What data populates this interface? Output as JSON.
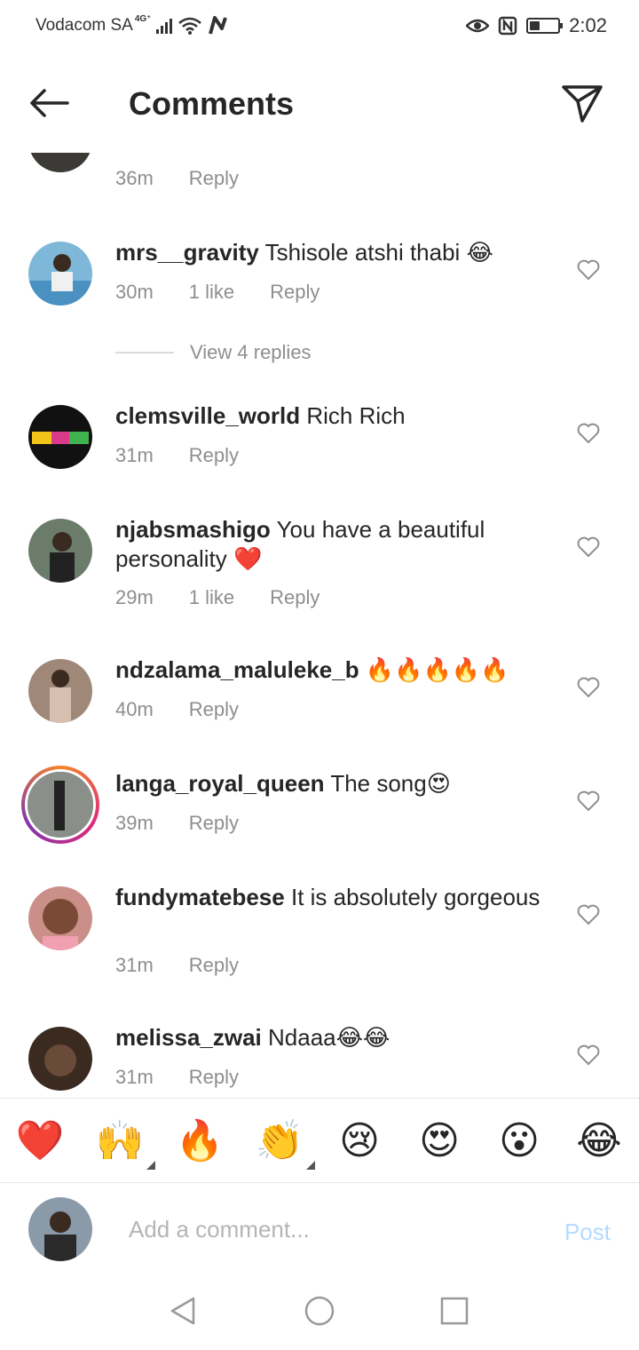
{
  "status_bar": {
    "carrier": "Vodacom SA",
    "network": "4G⁺",
    "time": "2:02",
    "battery_level": 0.35
  },
  "header": {
    "title": "Comments",
    "back_icon": "arrow-left-icon",
    "share_icon": "send-icon"
  },
  "comments_partial": {
    "time": "36m",
    "reply": "Reply"
  },
  "comments": [
    {
      "username": "mrs__gravity",
      "text": "Tshisole atshi thabi 😂",
      "time": "30m",
      "likes": "1 like",
      "reply": "Reply",
      "view_replies": "View 4 replies",
      "avatar_color": "#7fb7d8"
    },
    {
      "username": "clemsville_world",
      "text": "Rich Rich",
      "time": "31m",
      "likes": "",
      "reply": "Reply",
      "avatar_color": "#111111"
    },
    {
      "username": "njabsmashigo",
      "text": "You have a beautiful personality ❤️",
      "time": "29m",
      "likes": "1 like",
      "reply": "Reply",
      "avatar_color": "#6b7d6a"
    },
    {
      "username": "ndzalama_maluleke_b",
      "text": "🔥🔥🔥🔥🔥",
      "time": "40m",
      "likes": "",
      "reply": "Reply",
      "avatar_color": "#a08878"
    },
    {
      "username": "langa_royal_queen",
      "text": "The song😍",
      "time": "39m",
      "likes": "",
      "reply": "Reply",
      "avatar_color": "#5a5a5a"
    },
    {
      "username": "fundymatebese",
      "text": "It is absolutely gorgeous",
      "time": "31m",
      "likes": "",
      "reply": "Reply",
      "avatar_color": "#c98f88"
    },
    {
      "username": "melissa_zwai",
      "text": "Ndaaa😂😂",
      "time": "31m",
      "likes": "",
      "reply": "Reply",
      "avatar_color": "#3a2a20"
    }
  ],
  "emoji_bar": [
    "❤️",
    "🙌",
    "🔥",
    "👏",
    "😢",
    "😍",
    "😮",
    "😂"
  ],
  "composer": {
    "placeholder": "Add a comment...",
    "post_label": "Post"
  }
}
